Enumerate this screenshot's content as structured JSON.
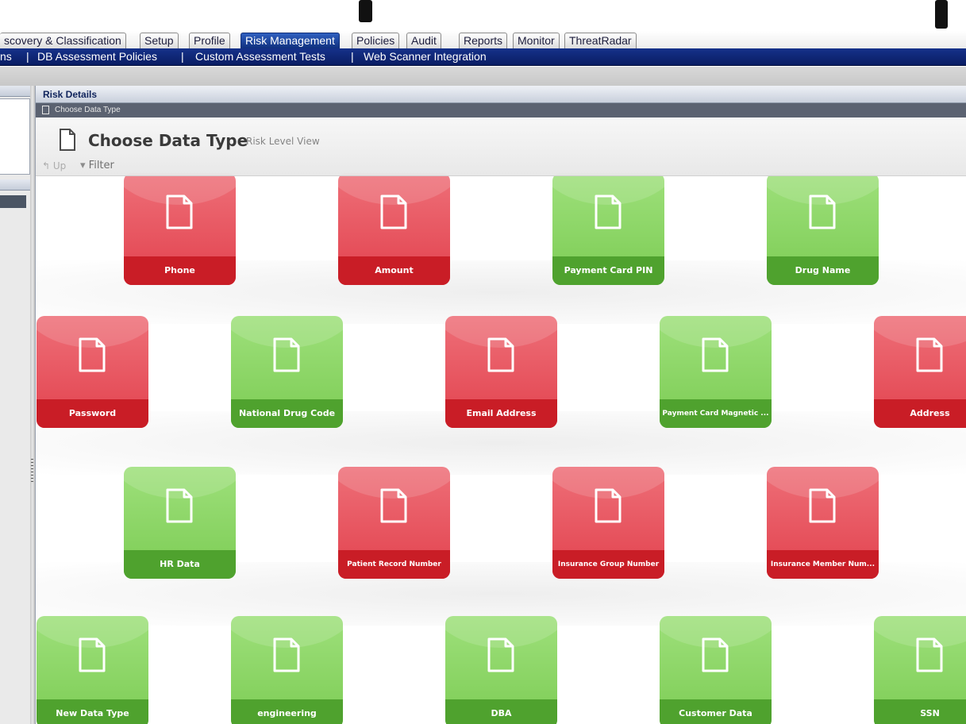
{
  "main_tabs": [
    {
      "label": "scovery & Classification",
      "active": false
    },
    {
      "label": "Setup",
      "active": false
    },
    {
      "label": "Profile",
      "active": false
    },
    {
      "label": "Risk Management",
      "active": true
    },
    {
      "label": "Policies",
      "active": false
    },
    {
      "label": "Audit",
      "active": false
    },
    {
      "label": "Reports",
      "active": false
    },
    {
      "label": "Monitor",
      "active": false
    },
    {
      "label": "ThreatRadar",
      "active": false
    }
  ],
  "sub_nav": [
    "ns",
    "DB Assessment Policies",
    "Custom Assessment Tests",
    "Web Scanner Integration"
  ],
  "sub_nav_separator": "|",
  "panel_title": "Risk Details",
  "breadcrumb": "Choose Data Type",
  "header": {
    "title": "Choose Data Type",
    "subtitle": "Risk Level View",
    "up_label": "Up",
    "filter_label": "Filter"
  },
  "colors": {
    "high_risk": "#e2424e",
    "low_risk": "#7ccc54",
    "nav_blue": "#15318a"
  },
  "tiles": [
    {
      "label": "Phone",
      "risk": "red"
    },
    {
      "label": "Amount",
      "risk": "red"
    },
    {
      "label": "Payment Card PIN",
      "risk": "green"
    },
    {
      "label": "Drug Name",
      "risk": "green"
    },
    {
      "label": "Password",
      "risk": "red"
    },
    {
      "label": "National Drug Code",
      "risk": "green"
    },
    {
      "label": "Email Address",
      "risk": "red"
    },
    {
      "label": "Payment Card Magnetic ...",
      "risk": "green"
    },
    {
      "label": "Address",
      "risk": "red"
    },
    {
      "label": "HR Data",
      "risk": "green"
    },
    {
      "label": "Patient Record Number",
      "risk": "red"
    },
    {
      "label": "Insurance Group Number",
      "risk": "red"
    },
    {
      "label": "Insurance Member Num...",
      "risk": "red"
    },
    {
      "label": "New Data Type",
      "risk": "green"
    },
    {
      "label": "engineering",
      "risk": "green"
    },
    {
      "label": "DBA",
      "risk": "green"
    },
    {
      "label": "Customer Data",
      "risk": "green"
    },
    {
      "label": "SSN",
      "risk": "green"
    }
  ]
}
